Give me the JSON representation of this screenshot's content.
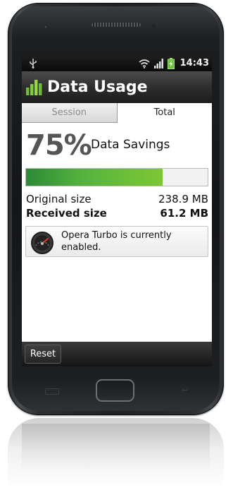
{
  "status_bar": {
    "time": "14:43",
    "icons": [
      "usb-icon",
      "wifi-icon",
      "signal-icon",
      "battery-charging-icon"
    ]
  },
  "app": {
    "title": "Data Usage",
    "icon": "bar-chart-icon"
  },
  "tabs": [
    {
      "label": "Session",
      "selected": false
    },
    {
      "label": "Total",
      "selected": true
    }
  ],
  "savings": {
    "percent_label": "75%",
    "label": "Data Savings",
    "fraction": 0.75
  },
  "sizes": {
    "original_label": "Original size",
    "original_value": "238.9 MB",
    "received_label": "Received size",
    "received_value": "61.2 MB"
  },
  "notice": {
    "icon": "speedometer-icon",
    "text": "Opera Turbo is currently enabled."
  },
  "bottom_bar": {
    "reset_label": "Reset"
  },
  "colors": {
    "progress_start": "#2d8a38",
    "progress_end": "#7dc834",
    "accent_icon": "#6bbf2a"
  }
}
